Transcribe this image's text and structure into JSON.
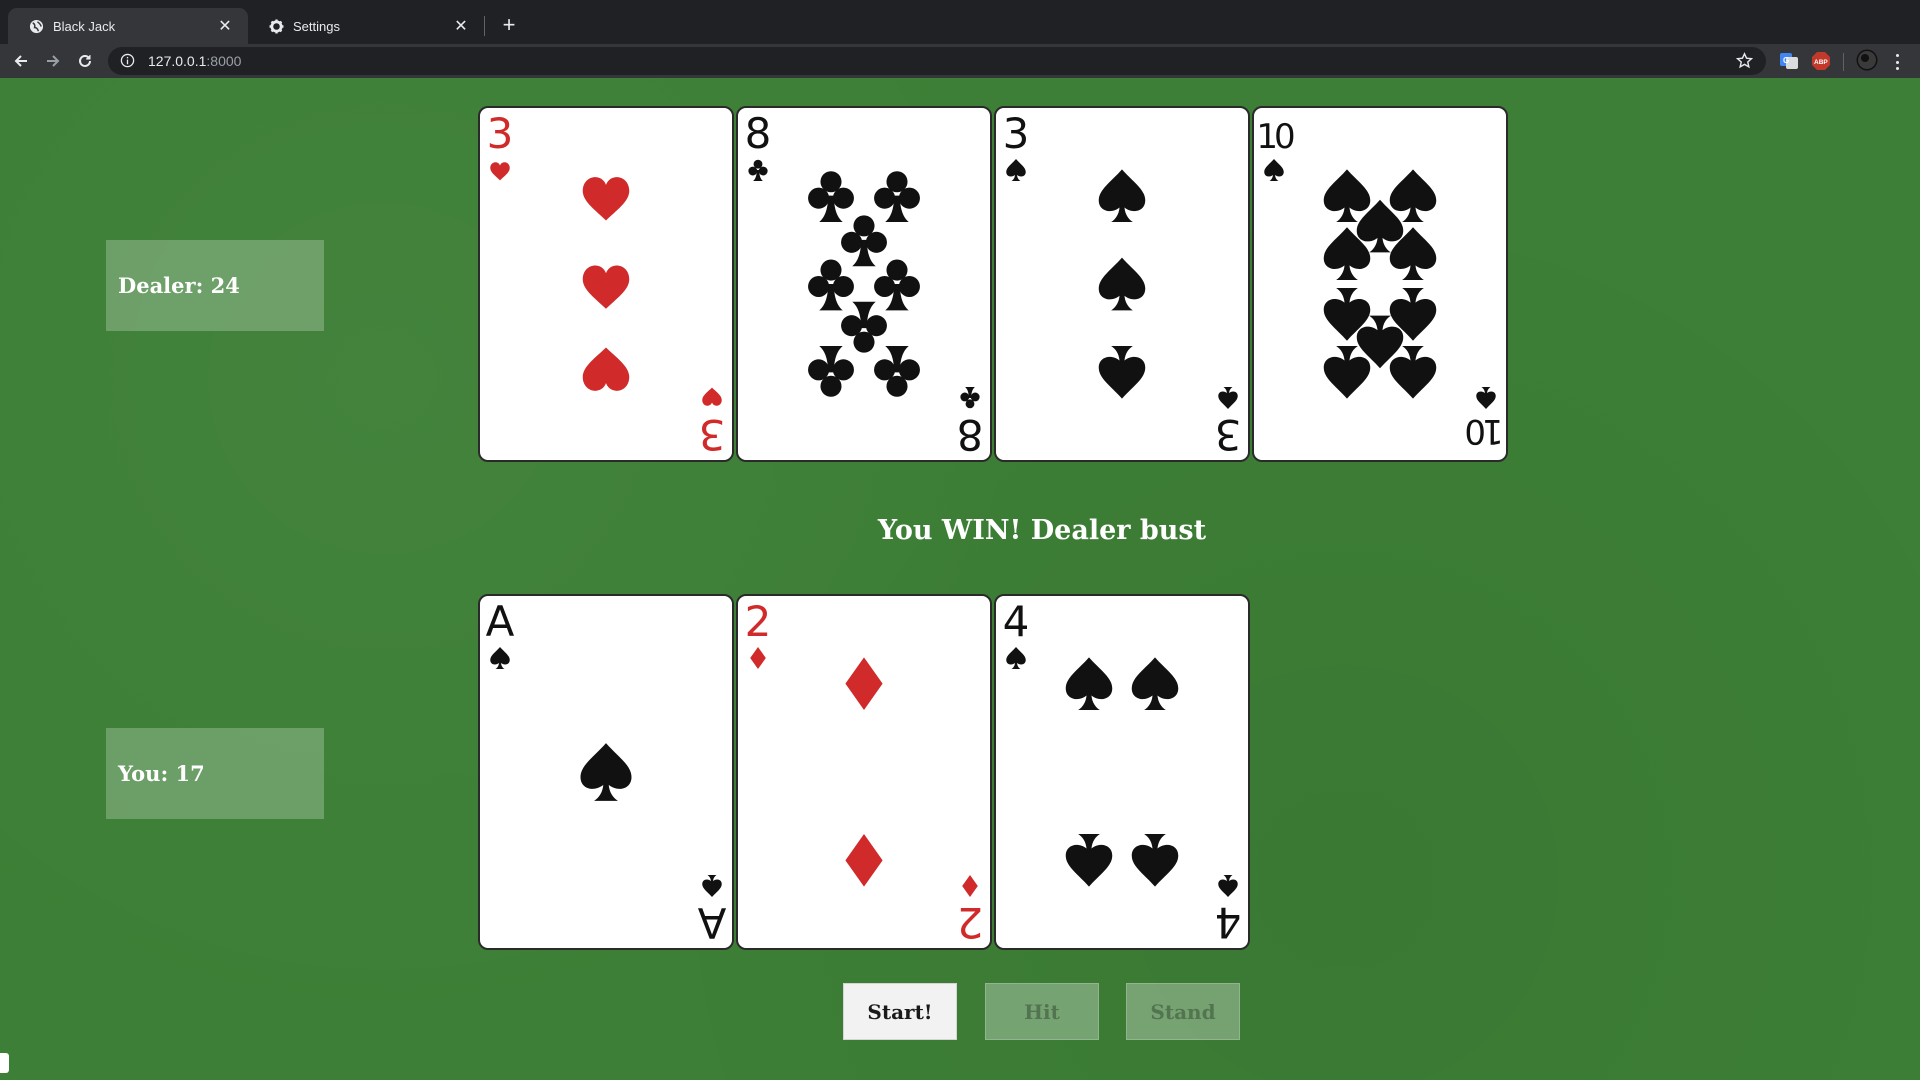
{
  "browser": {
    "tabs": [
      {
        "title": "Black Jack",
        "icon": "globe-icon",
        "active": true
      },
      {
        "title": "Settings",
        "icon": "gear-icon",
        "active": false
      }
    ],
    "url_host": "127.0.0.1",
    "url_port": ":8000",
    "extensions": [
      "translate-icon",
      "adblock-icon",
      "profile-avatar"
    ]
  },
  "game": {
    "dealer_label": "Dealer: 24",
    "player_label": "You: 17",
    "result_text": "You WIN! Dealer bust",
    "dealer_cards": [
      {
        "rank": "3",
        "suit": "hearts"
      },
      {
        "rank": "8",
        "suit": "clubs"
      },
      {
        "rank": "3",
        "suit": "spades"
      },
      {
        "rank": "10",
        "suit": "spades"
      }
    ],
    "player_cards": [
      {
        "rank": "A",
        "suit": "spades"
      },
      {
        "rank": "2",
        "suit": "diamonds"
      },
      {
        "rank": "4",
        "suit": "spades"
      }
    ],
    "buttons": {
      "start": "Start!",
      "hit": "Hit",
      "stand": "Stand"
    }
  },
  "colors": {
    "felt": "#3d7f36",
    "red_suit": "#d12a2a",
    "black_suit": "#111111"
  }
}
